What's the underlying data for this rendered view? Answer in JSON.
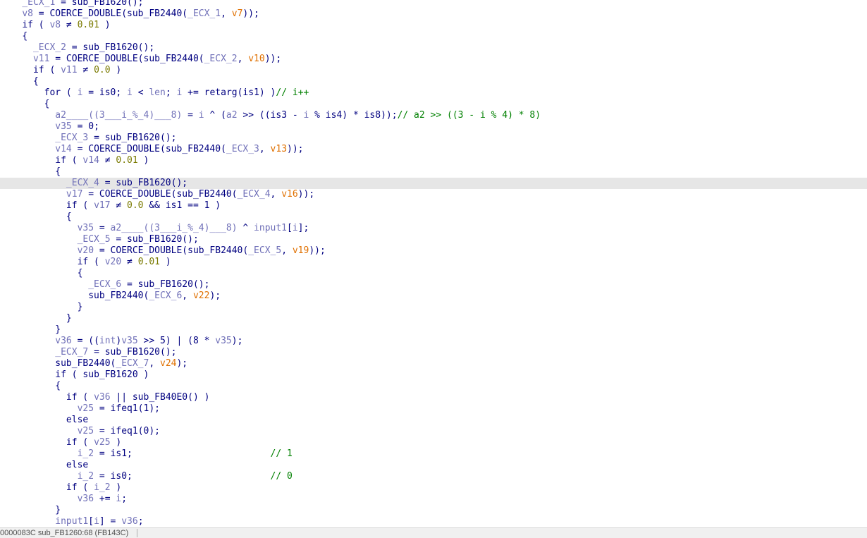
{
  "colors": {
    "background": "#ffffff",
    "plain_text": "#000080",
    "variable": "#7070b8",
    "number": "#7a7a00",
    "argument": "#e07000",
    "comment": "#008000",
    "highlight_line": "#e6e6e6"
  },
  "code_lines": [
    {
      "indent": 4,
      "tokens": [
        [
          "v",
          "_ECX_1"
        ],
        [
          "p",
          " = sub_FB1620();"
        ]
      ]
    },
    {
      "indent": 4,
      "tokens": [
        [
          "v",
          "v8"
        ],
        [
          "p",
          " = COERCE_DOUBLE(sub_FB2440("
        ],
        [
          "v",
          "_ECX_1"
        ],
        [
          "p",
          ", "
        ],
        [
          "a",
          "v7"
        ],
        [
          "p",
          "));"
        ]
      ]
    },
    {
      "indent": 4,
      "tokens": [
        [
          "k",
          "if"
        ],
        [
          "p",
          " ( "
        ],
        [
          "v",
          "v8"
        ],
        [
          "p",
          " ≠ "
        ],
        [
          "n",
          "0.01"
        ],
        [
          "p",
          " )"
        ]
      ]
    },
    {
      "indent": 4,
      "tokens": [
        [
          "p",
          "{"
        ]
      ]
    },
    {
      "indent": 6,
      "tokens": [
        [
          "v",
          "_ECX_2"
        ],
        [
          "p",
          " = sub_FB1620();"
        ]
      ]
    },
    {
      "indent": 6,
      "tokens": [
        [
          "v",
          "v11"
        ],
        [
          "p",
          " = COERCE_DOUBLE(sub_FB2440("
        ],
        [
          "v",
          "_ECX_2"
        ],
        [
          "p",
          ", "
        ],
        [
          "a",
          "v10"
        ],
        [
          "p",
          "));"
        ]
      ]
    },
    {
      "indent": 6,
      "tokens": [
        [
          "k",
          "if"
        ],
        [
          "p",
          " ( "
        ],
        [
          "v",
          "v11"
        ],
        [
          "p",
          " ≠ "
        ],
        [
          "n",
          "0.0"
        ],
        [
          "p",
          " )"
        ]
      ]
    },
    {
      "indent": 6,
      "tokens": [
        [
          "p",
          "{"
        ]
      ]
    },
    {
      "indent": 8,
      "tokens": [
        [
          "k",
          "for"
        ],
        [
          "p",
          " ( "
        ],
        [
          "v",
          "i"
        ],
        [
          "p",
          " = is0; "
        ],
        [
          "v",
          "i"
        ],
        [
          "p",
          " < "
        ],
        [
          "v",
          "len"
        ],
        [
          "p",
          "; "
        ],
        [
          "v",
          "i"
        ],
        [
          "p",
          " += retarg(is1) )"
        ],
        [
          "c",
          "// i++"
        ]
      ]
    },
    {
      "indent": 8,
      "tokens": [
        [
          "p",
          "{"
        ]
      ]
    },
    {
      "indent": 10,
      "tokens": [
        [
          "v",
          "a2____((3___i_%_4)___8)"
        ],
        [
          "p",
          " = "
        ],
        [
          "v",
          "i"
        ],
        [
          "p",
          " ^ ("
        ],
        [
          "v",
          "a2"
        ],
        [
          "p",
          " >> ((is3 - "
        ],
        [
          "v",
          "i"
        ],
        [
          "p",
          " % is4) * is8));"
        ],
        [
          "c",
          "// a2 >> ((3 - i % 4) * 8)"
        ]
      ]
    },
    {
      "indent": 10,
      "tokens": [
        [
          "v",
          "v35"
        ],
        [
          "p",
          " = 0;"
        ]
      ]
    },
    {
      "indent": 10,
      "tokens": [
        [
          "v",
          "_ECX_3"
        ],
        [
          "p",
          " = sub_FB1620();"
        ]
      ]
    },
    {
      "indent": 10,
      "tokens": [
        [
          "v",
          "v14"
        ],
        [
          "p",
          " = COERCE_DOUBLE(sub_FB2440("
        ],
        [
          "v",
          "_ECX_3"
        ],
        [
          "p",
          ", "
        ],
        [
          "a",
          "v13"
        ],
        [
          "p",
          "));"
        ]
      ]
    },
    {
      "indent": 10,
      "tokens": [
        [
          "k",
          "if"
        ],
        [
          "p",
          " ( "
        ],
        [
          "v",
          "v14"
        ],
        [
          "p",
          " ≠ "
        ],
        [
          "n",
          "0.01"
        ],
        [
          "p",
          " )"
        ]
      ]
    },
    {
      "indent": 10,
      "tokens": [
        [
          "p",
          "{"
        ]
      ]
    },
    {
      "indent": 12,
      "highlight": true,
      "tokens": [
        [
          "v",
          "_ECX_4"
        ],
        [
          "p",
          " = sub_FB1620();"
        ]
      ]
    },
    {
      "indent": 12,
      "tokens": [
        [
          "v",
          "v17"
        ],
        [
          "p",
          " = COERCE_DOUBLE(sub_FB2440("
        ],
        [
          "v",
          "_ECX_4"
        ],
        [
          "p",
          ", "
        ],
        [
          "a",
          "v16"
        ],
        [
          "p",
          "));"
        ]
      ]
    },
    {
      "indent": 12,
      "tokens": [
        [
          "k",
          "if"
        ],
        [
          "p",
          " ( "
        ],
        [
          "v",
          "v17"
        ],
        [
          "p",
          " ≠ "
        ],
        [
          "n",
          "0.0"
        ],
        [
          "p",
          " && is1 == 1 )"
        ]
      ]
    },
    {
      "indent": 12,
      "tokens": [
        [
          "p",
          "{"
        ]
      ]
    },
    {
      "indent": 14,
      "tokens": [
        [
          "v",
          "v35"
        ],
        [
          "p",
          " = "
        ],
        [
          "v",
          "a2____((3___i_%_4)___8)"
        ],
        [
          "p",
          " ^ "
        ],
        [
          "v",
          "input1"
        ],
        [
          "p",
          "["
        ],
        [
          "v",
          "i"
        ],
        [
          "p",
          "];"
        ]
      ]
    },
    {
      "indent": 14,
      "tokens": [
        [
          "v",
          "_ECX_5"
        ],
        [
          "p",
          " = sub_FB1620();"
        ]
      ]
    },
    {
      "indent": 14,
      "tokens": [
        [
          "v",
          "v20"
        ],
        [
          "p",
          " = COERCE_DOUBLE(sub_FB2440("
        ],
        [
          "v",
          "_ECX_5"
        ],
        [
          "p",
          ", "
        ],
        [
          "a",
          "v19"
        ],
        [
          "p",
          "));"
        ]
      ]
    },
    {
      "indent": 14,
      "tokens": [
        [
          "k",
          "if"
        ],
        [
          "p",
          " ( "
        ],
        [
          "v",
          "v20"
        ],
        [
          "p",
          " ≠ "
        ],
        [
          "n",
          "0.01"
        ],
        [
          "p",
          " )"
        ]
      ]
    },
    {
      "indent": 14,
      "tokens": [
        [
          "p",
          "{"
        ]
      ]
    },
    {
      "indent": 16,
      "tokens": [
        [
          "v",
          "_ECX_6"
        ],
        [
          "p",
          " = sub_FB1620();"
        ]
      ]
    },
    {
      "indent": 16,
      "tokens": [
        [
          "p",
          "sub_FB2440("
        ],
        [
          "v",
          "_ECX_6"
        ],
        [
          "p",
          ", "
        ],
        [
          "a",
          "v22"
        ],
        [
          "p",
          ");"
        ]
      ]
    },
    {
      "indent": 14,
      "tokens": [
        [
          "p",
          "}"
        ]
      ]
    },
    {
      "indent": 12,
      "tokens": [
        [
          "p",
          "}"
        ]
      ]
    },
    {
      "indent": 10,
      "tokens": [
        [
          "p",
          "}"
        ]
      ]
    },
    {
      "indent": 10,
      "tokens": [
        [
          "v",
          "v36"
        ],
        [
          "p",
          " = (("
        ],
        [
          "ty",
          "int"
        ],
        [
          "p",
          ")"
        ],
        [
          "v",
          "v35"
        ],
        [
          "p",
          " >> 5) | (8 * "
        ],
        [
          "v",
          "v35"
        ],
        [
          "p",
          ");"
        ]
      ]
    },
    {
      "indent": 10,
      "tokens": [
        [
          "v",
          "_ECX_7"
        ],
        [
          "p",
          " = sub_FB1620();"
        ]
      ]
    },
    {
      "indent": 10,
      "tokens": [
        [
          "p",
          "sub_FB2440("
        ],
        [
          "v",
          "_ECX_7"
        ],
        [
          "p",
          ", "
        ],
        [
          "a",
          "v24"
        ],
        [
          "p",
          ");"
        ]
      ]
    },
    {
      "indent": 10,
      "tokens": [
        [
          "k",
          "if"
        ],
        [
          "p",
          " ( sub_FB1620 )"
        ]
      ]
    },
    {
      "indent": 10,
      "tokens": [
        [
          "p",
          "{"
        ]
      ]
    },
    {
      "indent": 12,
      "tokens": [
        [
          "k",
          "if"
        ],
        [
          "p",
          " ( "
        ],
        [
          "v",
          "v36"
        ],
        [
          "p",
          " || sub_FB40E0() )"
        ]
      ]
    },
    {
      "indent": 14,
      "tokens": [
        [
          "v",
          "v25"
        ],
        [
          "p",
          " = ifeq1(1);"
        ]
      ]
    },
    {
      "indent": 12,
      "tokens": [
        [
          "k",
          "else"
        ]
      ]
    },
    {
      "indent": 14,
      "tokens": [
        [
          "v",
          "v25"
        ],
        [
          "p",
          " = ifeq1(0);"
        ]
      ]
    },
    {
      "indent": 12,
      "tokens": [
        [
          "k",
          "if"
        ],
        [
          "p",
          " ( "
        ],
        [
          "v",
          "v25"
        ],
        [
          "p",
          " )"
        ]
      ]
    },
    {
      "indent": 14,
      "tokens": [
        [
          "v",
          "i_2"
        ],
        [
          "p",
          " = is1;                         "
        ],
        [
          "c",
          "// 1"
        ]
      ]
    },
    {
      "indent": 12,
      "tokens": [
        [
          "k",
          "else"
        ]
      ]
    },
    {
      "indent": 14,
      "tokens": [
        [
          "v",
          "i_2"
        ],
        [
          "p",
          " = is0;                         "
        ],
        [
          "c",
          "// 0"
        ]
      ]
    },
    {
      "indent": 12,
      "tokens": [
        [
          "k",
          "if"
        ],
        [
          "p",
          " ( "
        ],
        [
          "v",
          "i_2"
        ],
        [
          "p",
          " )"
        ]
      ]
    },
    {
      "indent": 14,
      "tokens": [
        [
          "v",
          "v36"
        ],
        [
          "p",
          " += "
        ],
        [
          "v",
          "i"
        ],
        [
          "p",
          ";"
        ]
      ]
    },
    {
      "indent": 10,
      "tokens": [
        [
          "p",
          "}"
        ]
      ]
    },
    {
      "indent": 10,
      "tokens": [
        [
          "v",
          "input1"
        ],
        [
          "p",
          "["
        ],
        [
          "v",
          "i"
        ],
        [
          "p",
          "] = "
        ],
        [
          "v",
          "v36"
        ],
        [
          "p",
          ";"
        ]
      ]
    }
  ],
  "status_bar": {
    "text": "0000083C sub_FB1260:68 (FB143C)"
  }
}
